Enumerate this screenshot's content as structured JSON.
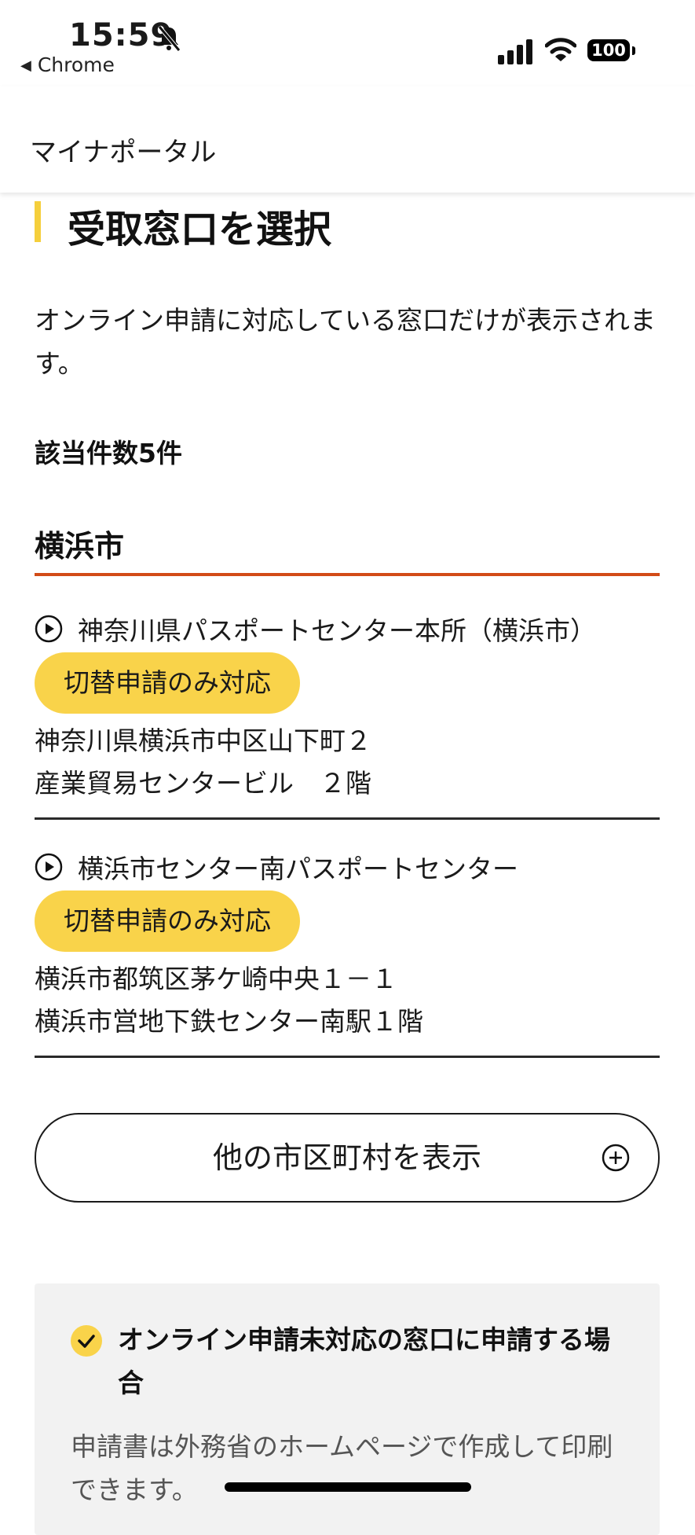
{
  "status_bar": {
    "time": "15:59",
    "back_app": "Chrome",
    "battery": "100"
  },
  "header": {
    "brand": "マイナポータル"
  },
  "main": {
    "title": "受取窓口を選択",
    "description": "オンライン申請に対応している窓口だけが表示されます。",
    "count": "該当件数5件",
    "city": "横浜市",
    "offices": [
      {
        "name": "神奈川県パスポートセンター本所（横浜市）",
        "badge": "切替申請のみ対応",
        "address_line1": "神奈川県横浜市中区山下町２",
        "address_line2": "産業貿易センタービル　２階"
      },
      {
        "name": "横浜市センター南パスポートセンター",
        "badge": "切替申請のみ対応",
        "address_line1": "横浜市都筑区茅ケ崎中央１－１",
        "address_line2": "横浜市営地下鉄センター南駅１階"
      }
    ],
    "more_button": "他の市区町村を表示"
  },
  "notice": {
    "heading": "オンライン申請未対応の窓口に申請する場合",
    "body": "申請書は外務省のホームページで作成して印刷できます。"
  },
  "colors": {
    "accent_yellow": "#f9d34a",
    "title_bar": "#f5cf3c",
    "city_underline": "#d24b17",
    "notice_bg": "#f2f2f2"
  }
}
